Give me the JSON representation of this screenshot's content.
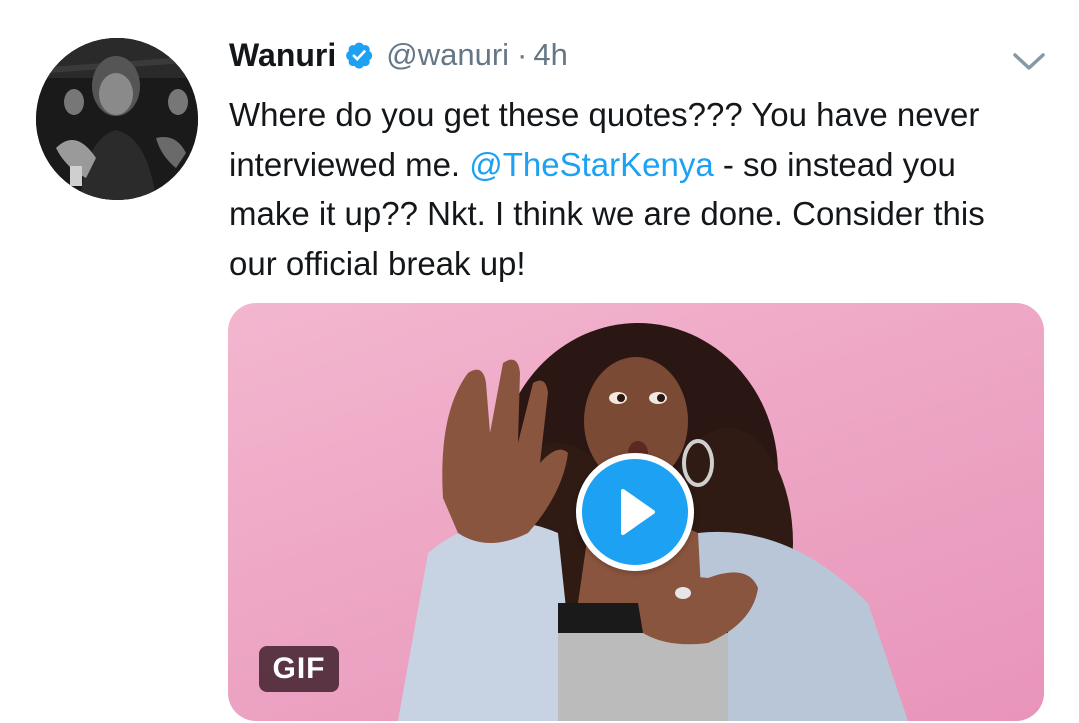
{
  "tweet": {
    "author": {
      "display_name": "Wanuri",
      "verified": true,
      "handle": "@wanuri",
      "separator": "·",
      "time": "4h"
    },
    "text": {
      "part1": "Where do you get these quotes??? You have never interviewed me. ",
      "mention": "@TheStarKenya",
      "part2": " - so instead you make it up?? Nkt. I think we are done. Consider this our official break up!"
    },
    "media": {
      "badge_label": "GIF"
    }
  },
  "icons": {
    "verified": "verified-badge-icon",
    "menu": "chevron-down-icon",
    "play": "play-icon"
  },
  "colors": {
    "link": "#1da1f2",
    "secondary_text": "#657786",
    "primary_text": "#14171a",
    "verified_badge": "#1da1f2"
  }
}
